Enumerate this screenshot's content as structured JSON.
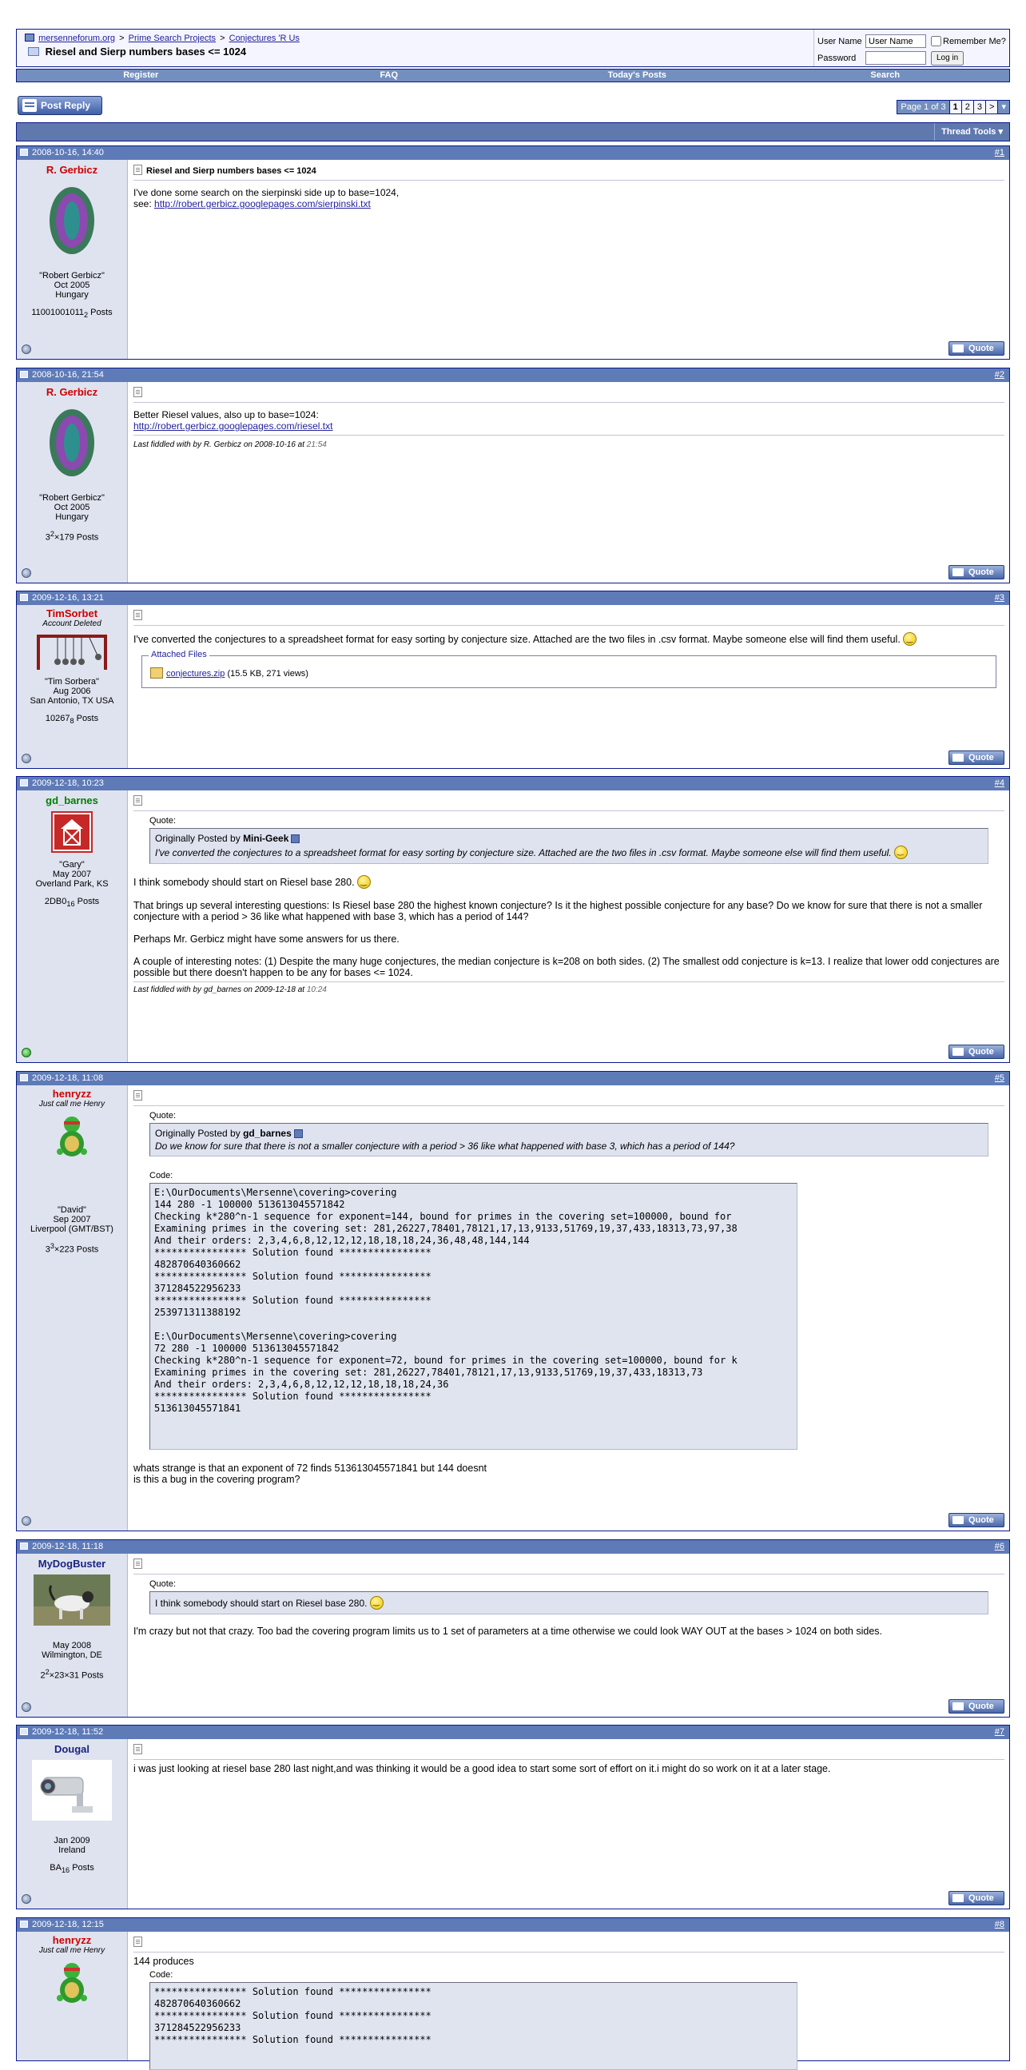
{
  "nav": {
    "breadcrumbs": [
      "mersenneforum.org",
      "Prime Search Projects",
      "Conjectures 'R Us"
    ],
    "sep": ">",
    "thread_title": "Riesel and Sierp numbers bases <= 1024",
    "login": {
      "username_label": "User Name",
      "username_value": "User Name",
      "remember_label": "Remember Me?",
      "password_label": "Password",
      "login_button": "Log in"
    }
  },
  "menu": [
    "Register",
    "FAQ",
    "Today's Posts",
    "Search"
  ],
  "toolbar": {
    "post_reply": "Post Reply",
    "page_label": "Page 1 of 3",
    "pages": [
      "1",
      "2",
      "3"
    ],
    "next": ">",
    "thread_tools": "Thread Tools"
  },
  "quote_button": "Quote",
  "quote_label": "Quote:",
  "code_label": "Code:",
  "posts": [
    {
      "date": "2008-10-16, 14:40",
      "num": "#1",
      "user": "R. Gerbicz",
      "user_color": "#cc0000",
      "real_name": "\"Robert Gerbicz\"",
      "joined": "Oct 2005",
      "location": "Hungary",
      "posts_base": "11001001011",
      "posts_sub": "2",
      "posts_suffix": " Posts",
      "title": "Riesel and Sierp numbers bases <= 1024",
      "line1": "I've done some search on the sierpinski side up to base=1024,",
      "line2_prefix": "see: ",
      "link": "http://robert.gerbicz.googlepages.com/sierpinski.txt"
    },
    {
      "date": "2008-10-16, 21:54",
      "num": "#2",
      "user": "R. Gerbicz",
      "real_name": "\"Robert Gerbicz\"",
      "joined": "Oct 2005",
      "location": "Hungary",
      "posts_base": "3",
      "posts_sup": "2",
      "posts_rest": "×179 Posts",
      "line1": "Better Riesel values, also up to base=1024:",
      "link": "http://robert.gerbicz.googlepages.com/riesel.txt",
      "edited": "Last fiddled with by R. Gerbicz on 2008-10-16 at",
      "edited_time": "21:54"
    },
    {
      "date": "2009-12-16, 13:21",
      "num": "#3",
      "user": "TimSorbet",
      "user_title": "Account Deleted",
      "real_name": "\"Tim Sorbera\"",
      "joined": "Aug 2006",
      "location": "San Antonio, TX USA",
      "posts_base": "10267",
      "posts_sub": "8",
      "posts_suffix": " Posts",
      "text": "I've converted the conjectures to a spreadsheet format for easy sorting by conjecture size. Attached are the two files in .csv format. Maybe someone else will find them useful.",
      "attach_legend": "Attached Files",
      "attach_file": "conjectures.zip",
      "attach_info": "(15.5 KB, 271 views)"
    },
    {
      "date": "2009-12-18, 10:23",
      "num": "#4",
      "user": "gd_barnes",
      "user_color": "#008000",
      "real_name": "\"Gary\"",
      "joined": "May 2007",
      "location": "Overland Park, KS",
      "posts_base": "2DB0",
      "posts_sub": "16",
      "posts_suffix": " Posts",
      "quote_prefix": "Originally Posted by",
      "quote_author": "Mini-Geek",
      "quote_text": "I've converted the conjectures to a spreadsheet format for easy sorting by conjecture size. Attached are the two files in .csv format. Maybe someone else will find them useful.",
      "p1": "I think somebody should start on Riesel base 280.",
      "p2": "That brings up several interesting questions: Is Riesel base 280 the highest known conjecture? Is it the highest possible conjecture for any base? Do we know for sure that there is not a smaller conjecture with a period > 36 like what happened with base 3, which has a period of 144?",
      "p3": "Perhaps Mr. Gerbicz might have some answers for us there.",
      "p4": "A couple of interesting notes: (1) Despite the many huge conjectures, the median conjecture is k=208 on both sides. (2) The smallest odd conjecture is k=13. I realize that lower odd conjectures are possible but there doesn't happen to be any for bases <= 1024.",
      "edited": "Last fiddled with by gd_barnes on 2009-12-18 at",
      "edited_time": "10:24"
    },
    {
      "date": "2009-12-18, 11:08",
      "num": "#5",
      "user": "henryzz",
      "user_title": "Just call me Henry",
      "real_name": "\"David\"",
      "joined": "Sep 2007",
      "location": "Liverpool (GMT/BST)",
      "posts_base": "3",
      "posts_sup": "3",
      "posts_rest": "×223 Posts",
      "quote_prefix": "Originally Posted by",
      "quote_author": "gd_barnes",
      "quote_text": "Do we know for sure that there is not a smaller conjecture with a period > 36 like what happened with base 3, which has a period of 144?",
      "code": "E:\\OurDocuments\\Mersenne\\covering>covering\n144 280 -1 100000 513613045571842\nChecking k*280^n-1 sequence for exponent=144, bound for primes in the covering set=100000, bound for\nExamining primes in the covering set: 281,26227,78401,78121,17,13,9133,51769,19,37,433,18313,73,97,38\nAnd their orders: 2,3,4,6,8,12,12,12,18,18,18,24,36,48,48,144,144\n**************** Solution found ****************\n482870640360662\n**************** Solution found ****************\n371284522956233\n**************** Solution found ****************\n253971311388192\n\nE:\\OurDocuments\\Mersenne\\covering>covering\n72 280 -1 100000 513613045571842\nChecking k*280^n-1 sequence for exponent=72, bound for primes in the covering set=100000, bound for k\nExamining primes in the covering set: 281,26227,78401,78121,17,13,9133,51769,19,37,433,18313,73\nAnd their orders: 2,3,4,6,8,12,12,12,18,18,18,24,36\n**************** Solution found ****************\n513613045571841",
      "line1": "whats strange is that an exponent of 72 finds 513613045571841 but 144 doesnt",
      "line2": "is this a bug in the covering program?"
    },
    {
      "date": "2009-12-18, 11:18",
      "num": "#6",
      "user": "MyDogBuster",
      "user_color": "#1a237e",
      "joined": "May 2008",
      "location": "Wilmington, DE",
      "posts_base": "2",
      "posts_sup": "2",
      "posts_rest": "×23×31 Posts",
      "quote_text": "I think somebody should start on Riesel base 280.",
      "text": "I'm crazy but not that crazy. Too bad the covering program limits us to 1 set of parameters at a time otherwise we could look WAY OUT at the bases > 1024 on both sides."
    },
    {
      "date": "2009-12-18, 11:52",
      "num": "#7",
      "user": "Dougal",
      "user_color": "#1a237e",
      "joined": "Jan 2009",
      "location": "Ireland",
      "posts_base": "BA",
      "posts_sub": "16",
      "posts_suffix": " Posts",
      "text": "i was just looking at riesel base 280 last night,and was thinking it would be a good idea to start some sort of effort on it.i might do so work on it at a later stage."
    },
    {
      "date": "2009-12-18, 12:15",
      "num": "#8",
      "user": "henryzz",
      "user_title": "Just call me Henry",
      "text": "144 produces",
      "code": "**************** Solution found ****************\n482870640360662\n**************** Solution found ****************\n371284522956233\n**************** Solution found ****************"
    }
  ]
}
